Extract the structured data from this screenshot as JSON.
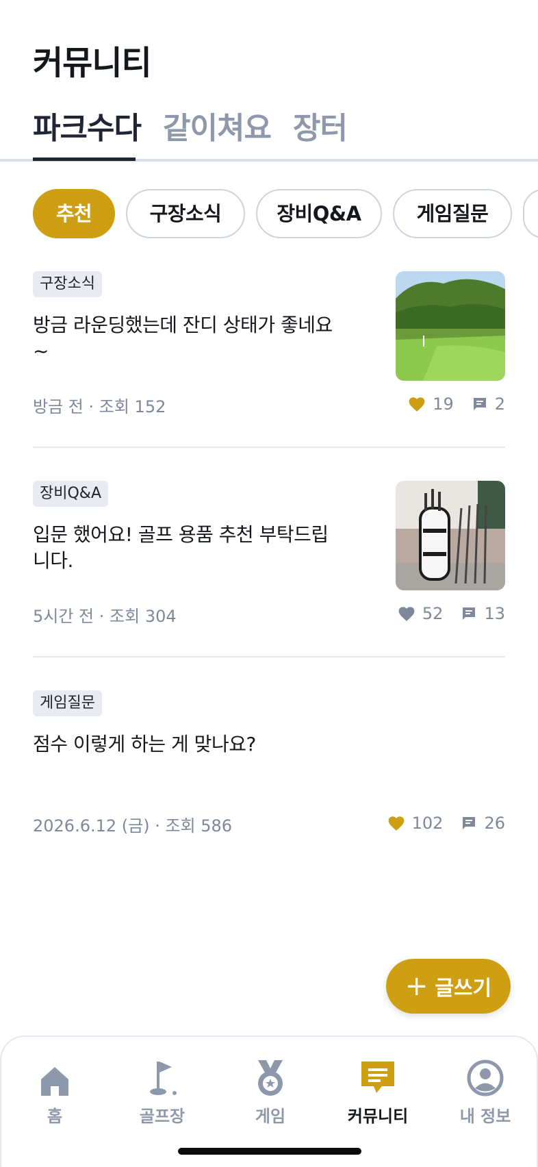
{
  "page_title": "커뮤니티",
  "tabs": [
    {
      "label": "파크수다",
      "active": true
    },
    {
      "label": "같이쳐요",
      "active": false
    },
    {
      "label": "장터",
      "active": false
    }
  ],
  "chips": [
    {
      "label": "추천",
      "active": true
    },
    {
      "label": "구장소식",
      "active": false
    },
    {
      "label": "장비Q&A",
      "active": false
    },
    {
      "label": "게임질문",
      "active": false
    }
  ],
  "posts": [
    {
      "tag": "구장소식",
      "title": "방금 라운딩했는데 잔디 상태가 좋네요~",
      "meta": "방금 전 · 조회 152",
      "likes": "19",
      "comments": "2",
      "liked": true,
      "thumbnail": "golf-course-photo"
    },
    {
      "tag": "장비Q&A",
      "title": "입문 했어요! 골프 용품 추천 부탁드립니다.",
      "meta": "5시간 전 · 조회 304",
      "likes": "52",
      "comments": "13",
      "liked": false,
      "thumbnail": "golf-bag-photo"
    },
    {
      "tag": "게임질문",
      "title": "점수 이렇게 하는 게 맞나요?",
      "meta": "2026.6.12 (금) · 조회 586",
      "likes": "102",
      "comments": "26",
      "liked": true,
      "thumbnail": null
    }
  ],
  "fab": {
    "label": "글쓰기"
  },
  "bottom_nav": [
    {
      "label": "홈",
      "icon": "home-icon",
      "active": false
    },
    {
      "label": "골프장",
      "icon": "golf-flag-icon",
      "active": false
    },
    {
      "label": "게임",
      "icon": "medal-icon",
      "active": false
    },
    {
      "label": "커뮤니티",
      "icon": "chat-icon",
      "active": true
    },
    {
      "label": "내 정보",
      "icon": "profile-icon",
      "active": false
    }
  ],
  "colors": {
    "accent": "#cf9f13",
    "muted": "#8d98aa",
    "text": "#14171c",
    "tag_bg": "#e8ecf2"
  }
}
